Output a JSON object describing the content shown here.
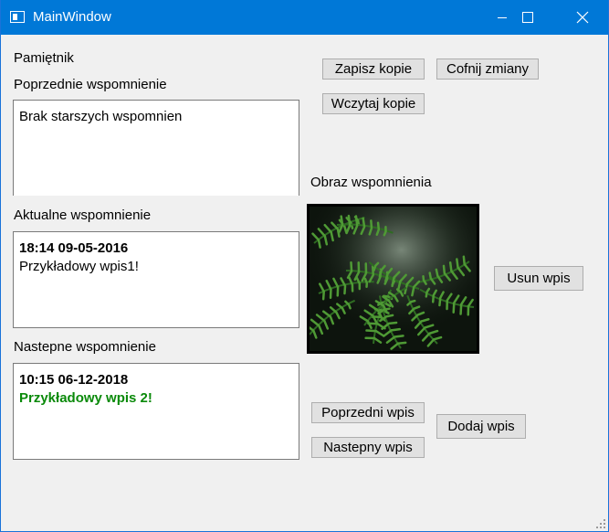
{
  "window": {
    "title": "MainWindow"
  },
  "labels": {
    "app_name": "Pamiętnik",
    "previous": "Poprzednie wspomnienie",
    "current": "Aktualne wspomnienie",
    "next": "Nastepne wspomnienie",
    "image": "Obraz wspomnienia"
  },
  "entries": {
    "previous_text": "Brak starszych wspomnien",
    "current_date": "18:14 09-05-2016",
    "current_text": "Przykładowy wpis1!",
    "next_date": "10:15 06-12-2018",
    "next_text": "Przykładowy wpis 2!",
    "next_text_color": "#0a8a0a"
  },
  "buttons": {
    "save_copy": "Zapisz kopie",
    "undo": "Cofnij zmiany",
    "load_copy": "Wczytaj kopie",
    "delete": "Usun wpis",
    "prev_entry": "Poprzedni wpis",
    "next_entry": "Nastepny wpis",
    "add_entry": "Dodaj wpis"
  },
  "icons": {
    "app": "window-app-icon",
    "minimize": "minimize-icon",
    "maximize": "maximize-icon",
    "close": "close-icon",
    "resize": "resize-grip-icon"
  },
  "colors": {
    "titlebar": "#0078d7",
    "accent_green": "#0a8a0a"
  }
}
